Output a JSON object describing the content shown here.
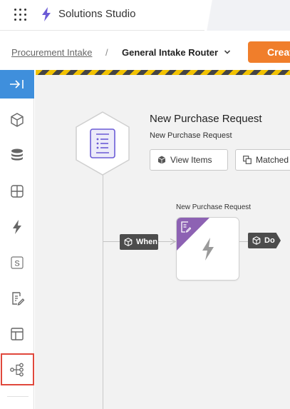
{
  "header": {
    "app_title": "Solutions Studio",
    "apps_icon": "apps-grid-icon",
    "brand_icon": "lightning-icon",
    "brand_color": "#6b5bd6"
  },
  "breadcrumb": {
    "parent": "Procurement Intake",
    "separator": "/",
    "current": "General Intake Router",
    "chevron_icon": "chevron-down-icon",
    "create_button": "Create"
  },
  "sidebar": {
    "collapse_icon": "expand-right-icon",
    "active_item": "flow",
    "active_border_color": "#e0483c",
    "items": [
      {
        "id": "objects",
        "icon": "cube-icon"
      },
      {
        "id": "data",
        "icon": "database-icon"
      },
      {
        "id": "layout",
        "icon": "grid-icon"
      },
      {
        "id": "automations",
        "icon": "lightning-icon"
      },
      {
        "id": "scripts",
        "icon": "s-badge-icon",
        "label": "S"
      },
      {
        "id": "forms",
        "icon": "edit-document-icon"
      },
      {
        "id": "templates",
        "icon": "layout-icon"
      },
      {
        "id": "flow",
        "icon": "flow-tree-icon"
      }
    ]
  },
  "canvas": {
    "trigger": {
      "icon": "document-list-icon",
      "title": "New Purchase Request",
      "subtitle": "New Purchase Request",
      "view_items_label": "View Items",
      "view_items_icon": "cube-icon",
      "matched_label": "Matched",
      "matched_icon": "copy-icon"
    },
    "node": {
      "label": "New Purchase Request",
      "badge_icon": "edit-document-icon",
      "body_icon": "lightning-icon",
      "badge_color": "#8d62b3"
    },
    "connectors": {
      "when_label": "When",
      "do_label": "Do",
      "tag_icon": "cube-icon"
    },
    "hazard_colors": [
      "#f2c200",
      "#444444"
    ]
  },
  "colors": {
    "accent": "#3f8fdc",
    "create": "#f07e2b",
    "canvas_bg": "#f2f2f2"
  }
}
